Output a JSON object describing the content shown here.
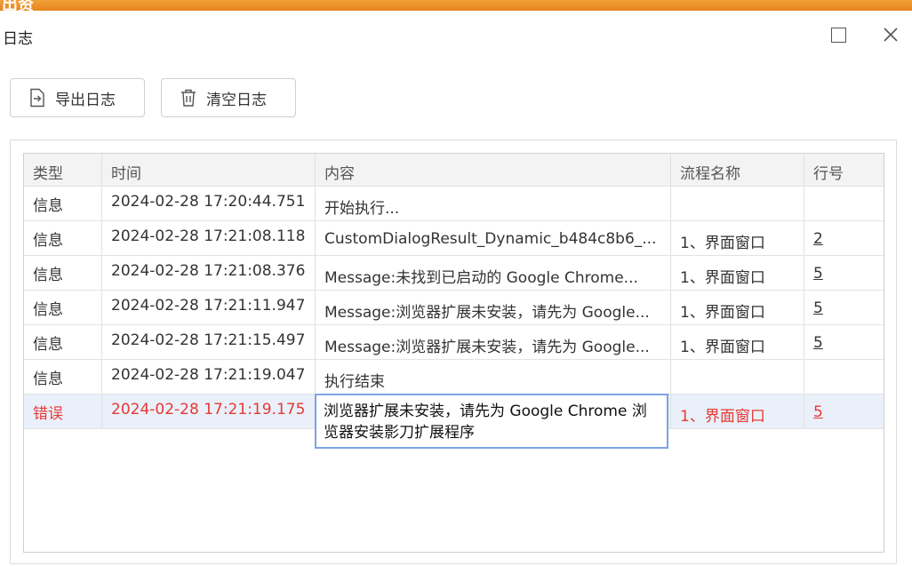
{
  "window": {
    "peek_text": "出资",
    "title": "日志"
  },
  "toolbar": {
    "export_label": "导出日志",
    "clear_label": "清空日志"
  },
  "table": {
    "headers": {
      "type": "类型",
      "time": "时间",
      "content": "内容",
      "flow": "流程名称",
      "line": "行号"
    },
    "rows": [
      {
        "type": "信息",
        "time": "2024-02-28 17:20:44.751",
        "content": "开始执行...",
        "flow": "",
        "line": ""
      },
      {
        "type": "信息",
        "time": "2024-02-28 17:21:08.118",
        "content": "CustomDialogResult_Dynamic_b484c8b6_...",
        "flow": "1、界面窗口",
        "line": "2"
      },
      {
        "type": "信息",
        "time": "2024-02-28 17:21:08.376",
        "content": "Message:未找到已启动的 Google Chrome...",
        "flow": "1、界面窗口",
        "line": "5"
      },
      {
        "type": "信息",
        "time": "2024-02-28 17:21:11.947",
        "content": "Message:浏览器扩展未安装，请先为 Google...",
        "flow": "1、界面窗口",
        "line": "5"
      },
      {
        "type": "信息",
        "time": "2024-02-28 17:21:15.497",
        "content": "Message:浏览器扩展未安装，请先为 Google...",
        "flow": "1、界面窗口",
        "line": "5"
      },
      {
        "type": "信息",
        "time": "2024-02-28 17:21:19.047",
        "content": "执行结束",
        "flow": "",
        "line": ""
      },
      {
        "type": "错误",
        "time": "2024-02-28 17:21:19.175",
        "content": "",
        "flow": "1、界面窗口",
        "line": "5"
      }
    ],
    "selected_editor_text": "浏览器扩展未安装，请先为 Google Chrome 浏览器安装影刀扩展程序"
  },
  "colors": {
    "error": "#e53935",
    "selected_row": "#eaf0f9",
    "editor_border": "#7aa3e5",
    "accent_strip": "#e8841c"
  },
  "icons": {
    "export": "export-file-icon",
    "clear": "trash-icon",
    "maximize": "maximize-icon",
    "close": "close-icon"
  }
}
